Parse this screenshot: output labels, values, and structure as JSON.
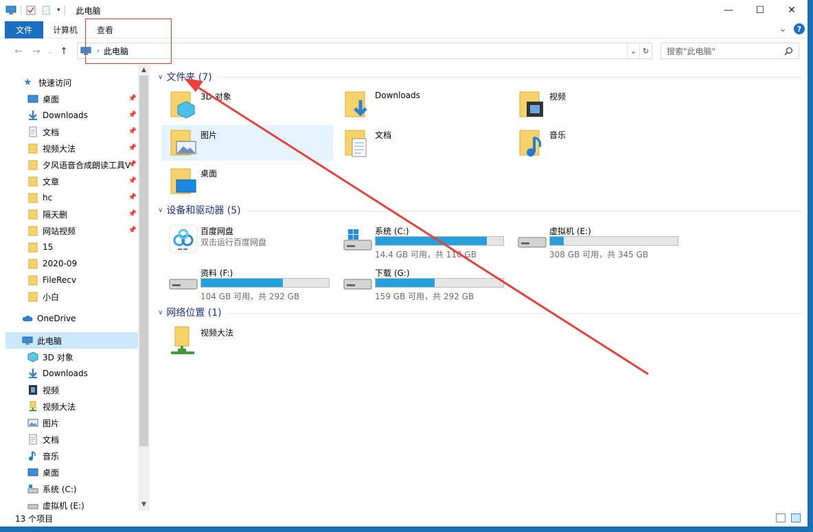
{
  "window": {
    "title": "此电脑",
    "minimize": "—",
    "maximize": "☐",
    "close": "✕"
  },
  "ribbon": {
    "tabs": [
      {
        "label": "文件"
      },
      {
        "label": "计算机"
      },
      {
        "label": "查看"
      }
    ],
    "expand": "⌄",
    "help": "?"
  },
  "address": {
    "path": "此电脑",
    "search_placeholder": "搜索\"此电脑\""
  },
  "sidebar": {
    "quick_access": "快速访问",
    "quick_items": [
      {
        "label": "桌面"
      },
      {
        "label": "Downloads"
      },
      {
        "label": "文档"
      },
      {
        "label": "视频大法"
      },
      {
        "label": "夕风语音合成朗读工具V"
      },
      {
        "label": "文章"
      },
      {
        "label": "hc"
      },
      {
        "label": "隔天删"
      },
      {
        "label": "网站视频"
      },
      {
        "label": "15"
      },
      {
        "label": "2020-09"
      },
      {
        "label": "FileRecv"
      },
      {
        "label": "小白"
      }
    ],
    "onedrive": "OneDrive",
    "this_pc": "此电脑",
    "pc_items": [
      {
        "label": "3D 对象"
      },
      {
        "label": "Downloads"
      },
      {
        "label": "视频"
      },
      {
        "label": "视频大法"
      },
      {
        "label": "图片"
      },
      {
        "label": "文档"
      },
      {
        "label": "音乐"
      },
      {
        "label": "桌面"
      },
      {
        "label": "系统 (C:)"
      },
      {
        "label": "虚拟机 (E:)"
      }
    ]
  },
  "content": {
    "folders_header": "文件夹 (7)",
    "folders": [
      {
        "label": "3D 对象"
      },
      {
        "label": "Downloads"
      },
      {
        "label": "视频"
      },
      {
        "label": "图片"
      },
      {
        "label": "文档"
      },
      {
        "label": "音乐"
      },
      {
        "label": "桌面"
      }
    ],
    "devices_header": "设备和驱动器 (5)",
    "baidu": {
      "label": "百度网盘",
      "sub": "双击运行百度网盘"
    },
    "drives": [
      {
        "label": "系统 (C:)",
        "usage": 0.87,
        "info": "14.4 GB 可用，共 110 GB"
      },
      {
        "label": "虚拟机 (E:)",
        "usage": 0.11,
        "info": "308 GB 可用，共 345 GB"
      },
      {
        "label": "资料 (F:)",
        "usage": 0.64,
        "info": "104 GB 可用，共 292 GB"
      },
      {
        "label": "下载 (G:)",
        "usage": 0.46,
        "info": "159 GB 可用，共 292 GB"
      }
    ],
    "network_header": "网络位置 (1)",
    "network": [
      {
        "label": "视频大法"
      }
    ]
  },
  "status": {
    "count": "13 个项目"
  }
}
